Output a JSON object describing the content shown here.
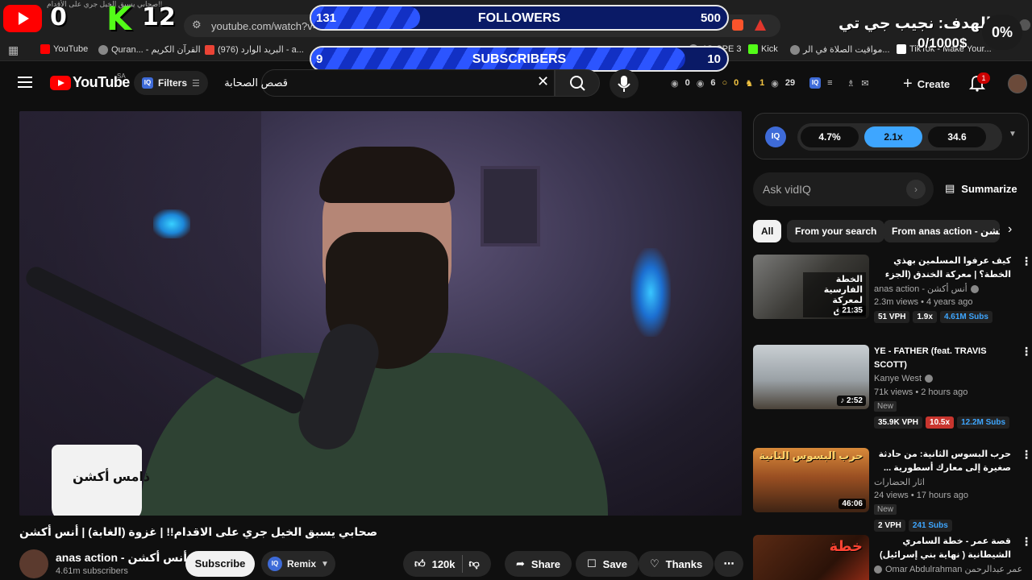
{
  "browser": {
    "tab_text": "صحابي يسبق الخيل جري على الأقدام!!",
    "address": "youtube.com/watch?v=",
    "bookmarks": [
      {
        "label": "YouTube",
        "icon": "youtube-icon",
        "color": "#ff0000"
      },
      {
        "label": "Quran... - القرآن الكريم",
        "icon": "quran-icon",
        "color": "#888888"
      },
      {
        "label": "البريد الوارد (976) - a...",
        "icon": "gmail-icon",
        "color": "#ea4335"
      },
      {
        "label": "4G CPE 3",
        "icon": "router-icon",
        "color": "#888888"
      },
      {
        "label": "Kick",
        "icon": "kick-icon",
        "color": "#53fc18"
      },
      {
        "label": "مواقيت الصلاة في الر...",
        "icon": "prayer-times-icon",
        "color": "#888888"
      },
      {
        "label": "TikTok - Make Your...",
        "icon": "tiktok-icon",
        "color": "#ffffff"
      }
    ]
  },
  "overlay": {
    "youtube_count": "0",
    "kick_letter": "K",
    "kick_count": "12",
    "followers": {
      "label": "FOLLOWERS",
      "current": "131",
      "max": "500",
      "progress": 0.262
    },
    "subscribers": {
      "label": "SUBSCRIBERS",
      "current": "9",
      "max": "10",
      "progress": 0.9
    },
    "goal_title": "الهدف: نجيب جي تي",
    "goal_amount": "0/1000$",
    "goal_percent": "0%"
  },
  "masthead": {
    "logo_text": "YouTube",
    "region": "SA",
    "filters_label": "Filters",
    "search_value": "قصص الصحابة",
    "stats": [
      "0",
      "6",
      "0",
      "1",
      "29"
    ],
    "create_label": "Create",
    "notification_count": "1"
  },
  "video": {
    "mug_text": "ذامس أكشن",
    "title": "صحابي يسبق الخيل جري على الاقدام!! | غزوة (الغابة) | أنس أكشن",
    "channel_name": "anas action - أنس أكشن",
    "subscribers": "4.61m subscribers",
    "subscribe_label": "Subscribe",
    "remix_label": "Remix",
    "likes": "120k",
    "share_label": "Share",
    "save_label": "Save",
    "thanks_label": "Thanks"
  },
  "vidiq": {
    "logo": "IQ",
    "metrics": [
      "4.7%",
      "2.1x",
      "34.6"
    ],
    "ask_placeholder": "Ask vidIQ",
    "summarize_label": "Summarize"
  },
  "chips": [
    "All",
    "From your search",
    "From anas action - أنس أكشن"
  ],
  "recommendations": [
    {
      "title": "كيف عرفوا المسلمين بهذي الخطة؟ | معركة الخندق (الجزء الأول) | أنس أكشن",
      "rtl": true,
      "channel": "anas action - أنس أكشن",
      "meta": "2.3m views • 4 years ago",
      "new": "",
      "duration": "21:35",
      "thumb_text": "الخطة الفارسية لمعركة الخندق",
      "stats": [
        "51 VPH",
        "1.9x",
        "4.61M Subs"
      ]
    },
    {
      "title": "YE - FATHER (feat. TRAVIS SCOTT)",
      "rtl": false,
      "channel": "Kanye West",
      "meta": "71k views • 2 hours ago",
      "new": "New",
      "duration": "♪ 2:52",
      "thumb_text": "",
      "stats": [
        "35.9K VPH",
        "10.5x",
        "12.2M Subs"
      ]
    },
    {
      "title": "حرب البسوس الثانية: من حادثة صغيرة إلى معارك أسطورية ... وثائقي للنوم",
      "rtl": true,
      "channel": "اثار الحضارات",
      "meta": "24 views • 17 hours ago",
      "new": "New",
      "duration": "46:06",
      "thumb_text": "حرب البسوس الثانية",
      "stats": [
        "2 VPH",
        "241 Subs"
      ]
    },
    {
      "title": "قصة عمر - خطة السامري الشيطانية ( نهاية بني إسرائيل)",
      "rtl": true,
      "channel": "Omar Abdulrahman عمر عبدالرحمن",
      "meta": "",
      "new": "",
      "duration": "",
      "thumb_text": "خطة",
      "stats": []
    }
  ]
}
